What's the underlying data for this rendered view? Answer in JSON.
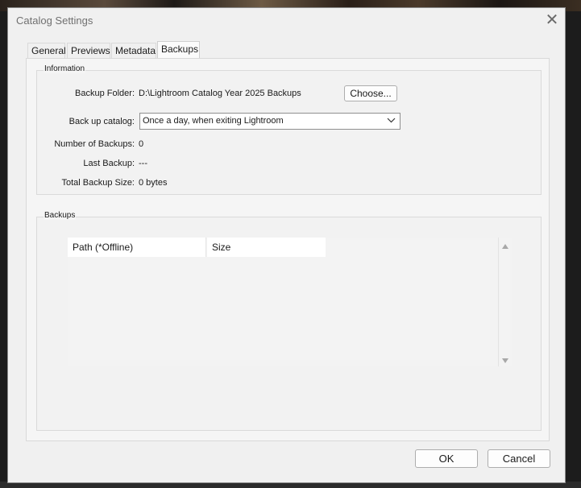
{
  "dialog": {
    "title": "Catalog Settings",
    "close_icon": "close-icon"
  },
  "tabs": [
    {
      "label": "General",
      "active": false
    },
    {
      "label": "Previews",
      "active": false
    },
    {
      "label": "Metadata",
      "active": false
    },
    {
      "label": "Backups",
      "active": true
    }
  ],
  "information": {
    "legend": "Information",
    "backup_folder_label": "Backup Folder:",
    "backup_folder_value": "D:\\Lightroom Catalog Year 2025 Backups",
    "choose_label": "Choose...",
    "backup_catalog_label": "Back up catalog:",
    "backup_catalog_value": "Once a day, when exiting Lightroom",
    "num_backups_label": "Number of Backups:",
    "num_backups_value": "0",
    "last_backup_label": "Last Backup:",
    "last_backup_value": "---",
    "total_size_label": "Total Backup Size:",
    "total_size_value": "0 bytes"
  },
  "backups": {
    "legend": "Backups",
    "columns": [
      "Path (*Offline)",
      "Size"
    ],
    "rows": []
  },
  "footer": {
    "ok_label": "OK",
    "cancel_label": "Cancel"
  }
}
